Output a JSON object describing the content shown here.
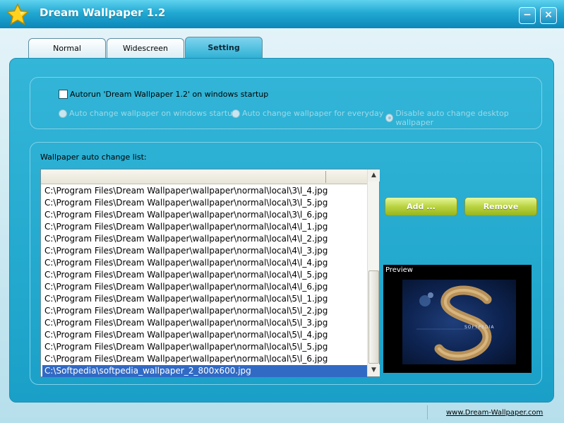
{
  "window": {
    "title": "Dream Wallpaper 1.2",
    "minimize": "−",
    "close": "×"
  },
  "tabs": [
    {
      "label": "Normal"
    },
    {
      "label": "Widescreen"
    },
    {
      "label": "Setting"
    }
  ],
  "startup": {
    "autorun_label": "Autorun 'Dream Wallpaper 1.2' on windows startup",
    "autorun_checked": false,
    "options": [
      {
        "label": "Auto change wallpaper on windows startup",
        "selected": false
      },
      {
        "label": "Auto change wallpaper for everyday",
        "selected": false
      },
      {
        "label": "Disable auto change desktop wallpaper",
        "selected": true
      }
    ]
  },
  "list": {
    "label": "Wallpaper auto change list:",
    "items": [
      "C:\\Program Files\\Dream Wallpaper\\wallpaper\\normal\\local\\3\\l_4.jpg",
      "C:\\Program Files\\Dream Wallpaper\\wallpaper\\normal\\local\\3\\l_5.jpg",
      "C:\\Program Files\\Dream Wallpaper\\wallpaper\\normal\\local\\3\\l_6.jpg",
      "C:\\Program Files\\Dream Wallpaper\\wallpaper\\normal\\local\\4\\l_1.jpg",
      "C:\\Program Files\\Dream Wallpaper\\wallpaper\\normal\\local\\4\\l_2.jpg",
      "C:\\Program Files\\Dream Wallpaper\\wallpaper\\normal\\local\\4\\l_3.jpg",
      "C:\\Program Files\\Dream Wallpaper\\wallpaper\\normal\\local\\4\\l_4.jpg",
      "C:\\Program Files\\Dream Wallpaper\\wallpaper\\normal\\local\\4\\l_5.jpg",
      "C:\\Program Files\\Dream Wallpaper\\wallpaper\\normal\\local\\4\\l_6.jpg",
      "C:\\Program Files\\Dream Wallpaper\\wallpaper\\normal\\local\\5\\l_1.jpg",
      "C:\\Program Files\\Dream Wallpaper\\wallpaper\\normal\\local\\5\\l_2.jpg",
      "C:\\Program Files\\Dream Wallpaper\\wallpaper\\normal\\local\\5\\l_3.jpg",
      "C:\\Program Files\\Dream Wallpaper\\wallpaper\\normal\\local\\5\\l_4.jpg",
      "C:\\Program Files\\Dream Wallpaper\\wallpaper\\normal\\local\\5\\l_5.jpg",
      "C:\\Program Files\\Dream Wallpaper\\wallpaper\\normal\\local\\5\\l_6.jpg",
      "C:\\Softpedia\\softpedia_wallpaper_2_800x600.jpg"
    ],
    "selected_index": 15
  },
  "buttons": {
    "add": "Add ...",
    "remove": "Remove"
  },
  "preview": {
    "label": "Preview",
    "image_text": "SOFTPEDIA"
  },
  "footer": {
    "link": "www.Dream-Wallpaper.com"
  },
  "colors": {
    "accent": "#1aa0c8",
    "button_green": "#b9d341",
    "selection": "#316ac5"
  },
  "icons": {
    "logo": "star-icon",
    "scroll_up": "arrow-up-icon",
    "scroll_down": "arrow-down-icon"
  }
}
